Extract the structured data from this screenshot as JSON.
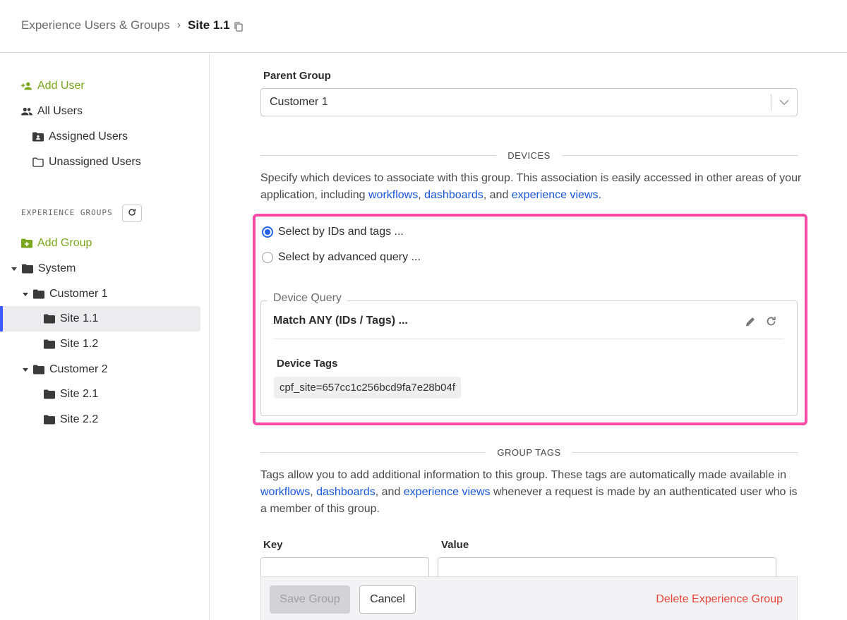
{
  "breadcrumb": {
    "parent": "Experience Users & Groups",
    "separator": "›",
    "current": "Site 1.1"
  },
  "sidebar": {
    "add_user": "Add User",
    "all_users": "All Users",
    "assigned_users": "Assigned Users",
    "unassigned_users": "Unassigned Users",
    "groups_label": "EXPERIENCE GROUPS",
    "add_group": "Add Group",
    "tree": {
      "system": "System",
      "customer1": "Customer 1",
      "site11": "Site 1.1",
      "site12": "Site 1.2",
      "customer2": "Customer 2",
      "site21": "Site 2.1",
      "site22": "Site 2.2"
    }
  },
  "form": {
    "parent_group_label": "Parent Group",
    "parent_group_value": "Customer 1",
    "devices_heading": "DEVICES",
    "devices_desc_1": "Specify which devices to associate with this group. This association is easily accessed in other areas of your application, including ",
    "link_workflows": "workflows",
    "link_dashboards": "dashboards",
    "link_experience_views": "experience views",
    "comma": ", ",
    "and": ", and ",
    "period": ".",
    "radio_ids_tags": "Select by IDs and tags ...",
    "radio_advanced": "Select by advanced query ...",
    "device_query_legend": "Device Query",
    "match_title": "Match ANY (IDs / Tags) ...",
    "device_tags_label": "Device Tags",
    "device_tag": "cpf_site=657cc1c256bcd9fa7e28b04f",
    "group_tags_heading": "GROUP TAGS",
    "group_tags_desc_1": "Tags allow you to add additional information to this group. These tags are automatically made available in ",
    "group_tags_desc_2": " whenever a request is made by an authenticated user who is a member of this group.",
    "key_label": "Key",
    "value_label": "Value"
  },
  "footer": {
    "save": "Save Group",
    "cancel": "Cancel",
    "delete": "Delete Experience Group"
  },
  "colors": {
    "accent": "#2563eb",
    "green": "#7aa61e",
    "highlight": "#f84aa7",
    "danger": "#e8443a"
  }
}
